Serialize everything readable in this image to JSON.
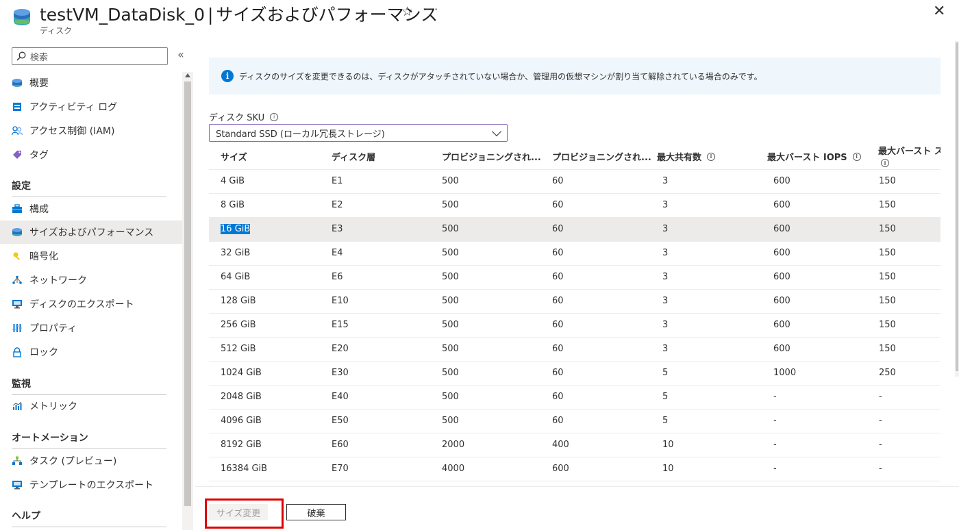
{
  "header": {
    "title_resource": "testVM_DataDisk_0",
    "title_separator": "|",
    "title_page": "サイズおよびパフォーマンス",
    "subtitle": "ディスク",
    "star_glyph": "☆",
    "more_glyph": "···",
    "close_glyph": "✕"
  },
  "sidebar": {
    "search_placeholder": "検索",
    "collapse_glyph": "«",
    "items": [
      {
        "label": "概要",
        "icon": "disk-icon"
      },
      {
        "label": "アクティビティ ログ",
        "icon": "activity-log-icon"
      },
      {
        "label": "アクセス制御 (IAM)",
        "icon": "people-icon"
      },
      {
        "label": "タグ",
        "icon": "tag-icon"
      }
    ],
    "sections": [
      {
        "title": "設定",
        "items": [
          {
            "label": "構成",
            "icon": "toolbox-icon"
          },
          {
            "label": "サイズおよびパフォーマンス",
            "icon": "disk-icon",
            "active": true
          },
          {
            "label": "暗号化",
            "icon": "key-icon"
          },
          {
            "label": "ネットワーク",
            "icon": "network-icon"
          },
          {
            "label": "ディスクのエクスポート",
            "icon": "export-icon"
          },
          {
            "label": "プロパティ",
            "icon": "properties-icon"
          },
          {
            "label": "ロック",
            "icon": "lock-icon"
          }
        ]
      },
      {
        "title": "監視",
        "items": [
          {
            "label": "メトリック",
            "icon": "metrics-icon"
          }
        ]
      },
      {
        "title": "オートメーション",
        "items": [
          {
            "label": "タスク (プレビュー)",
            "icon": "tasks-icon"
          },
          {
            "label": "テンプレートのエクスポート",
            "icon": "export-icon"
          }
        ]
      },
      {
        "title": "ヘルプ",
        "items": []
      }
    ]
  },
  "main": {
    "info_text": "ディスクのサイズを変更できるのは、ディスクがアタッチされていない場合か、管理用の仮想マシンが割り当て解除されている場合のみです。",
    "sku_label": "ディスク SKU",
    "sku_value": "Standard SSD (ローカル冗長ストレージ)",
    "columns": [
      "サイズ",
      "ディスク層",
      "プロビジョニングされ...",
      "プロビジョニングされ...",
      "最大共有数",
      "最大バースト IOPS",
      "最大バースト ス"
    ],
    "rows": [
      [
        "4 GiB",
        "E1",
        "500",
        "60",
        "3",
        "600",
        "150"
      ],
      [
        "8 GiB",
        "E2",
        "500",
        "60",
        "3",
        "600",
        "150"
      ],
      [
        "16 GiB",
        "E3",
        "500",
        "60",
        "3",
        "600",
        "150"
      ],
      [
        "32 GiB",
        "E4",
        "500",
        "60",
        "3",
        "600",
        "150"
      ],
      [
        "64 GiB",
        "E6",
        "500",
        "60",
        "3",
        "600",
        "150"
      ],
      [
        "128 GiB",
        "E10",
        "500",
        "60",
        "3",
        "600",
        "150"
      ],
      [
        "256 GiB",
        "E15",
        "500",
        "60",
        "3",
        "600",
        "150"
      ],
      [
        "512 GiB",
        "E20",
        "500",
        "60",
        "3",
        "600",
        "150"
      ],
      [
        "1024 GiB",
        "E30",
        "500",
        "60",
        "5",
        "1000",
        "250"
      ],
      [
        "2048 GiB",
        "E40",
        "500",
        "60",
        "5",
        "-",
        "-"
      ],
      [
        "4096 GiB",
        "E50",
        "500",
        "60",
        "5",
        "-",
        "-"
      ],
      [
        "8192 GiB",
        "E60",
        "2000",
        "400",
        "10",
        "-",
        "-"
      ],
      [
        "16384 GiB",
        "E70",
        "4000",
        "600",
        "10",
        "-",
        "-"
      ]
    ],
    "selected_row_index": 2,
    "buttons": {
      "resize": "サイズ変更",
      "discard": "破棄"
    }
  },
  "colors": {
    "accent": "#0078d4",
    "highlight_box": "#e00000",
    "selected_row": "#edebe9"
  }
}
